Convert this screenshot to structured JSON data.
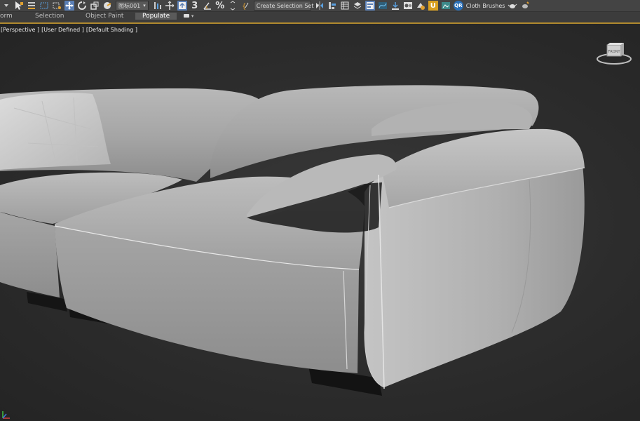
{
  "toolbar": {
    "named_selection_dropdown": "图标001",
    "create_selection_set": "Create Selection Set",
    "snap_angle_label": "3",
    "percent_snap_label": "%",
    "cloth_brushes": "Cloth Brushes",
    "qr_label": "QR",
    "u_label": "U"
  },
  "ribbon": {
    "tabs": [
      {
        "label": "orm"
      },
      {
        "label": "Selection"
      },
      {
        "label": "Object Paint"
      },
      {
        "label": "Populate"
      }
    ],
    "options_caret": "▾"
  },
  "viewport": {
    "label_view": "[Perspective ]",
    "label_user": "[User Defined ]",
    "label_shading": "[Default Shading ]",
    "viewcube_face": "FRONT"
  },
  "colors": {
    "accent": "#5a7fb5",
    "ribbon_gold": "#b08a2e",
    "background": "#2b2b2b"
  }
}
